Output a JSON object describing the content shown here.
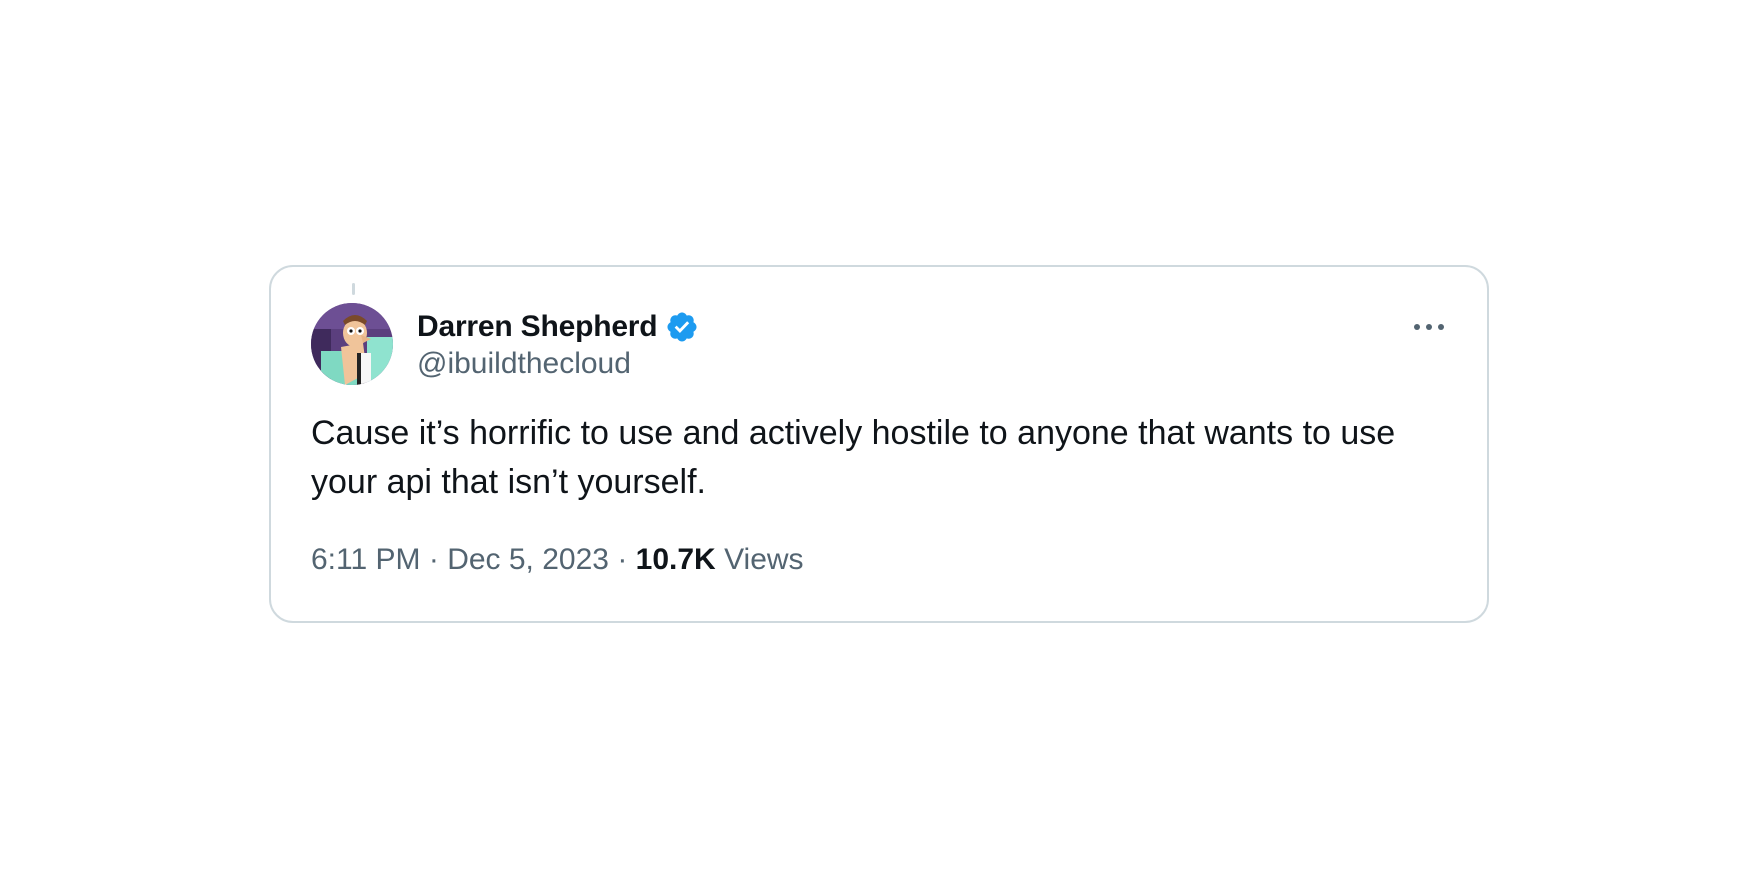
{
  "tweet": {
    "author": {
      "display_name": "Darren Shepherd",
      "handle": "@ibuildthecloud",
      "verified": true
    },
    "text": "Cause it’s horrific to use and actively hostile to anyone that wants to use your api that isn’t yourself.",
    "time": "6:11 PM",
    "separator": "·",
    "date": "Dec 5, 2023",
    "views_count": "10.7K",
    "views_label": "Views"
  },
  "icons": {
    "verified": "verified-badge-icon",
    "more": "more-options-icon"
  },
  "colors": {
    "verified_blue": "#1d9bf0",
    "text_primary": "#0f1419",
    "text_secondary": "#536471",
    "border": "#cfd9de"
  }
}
